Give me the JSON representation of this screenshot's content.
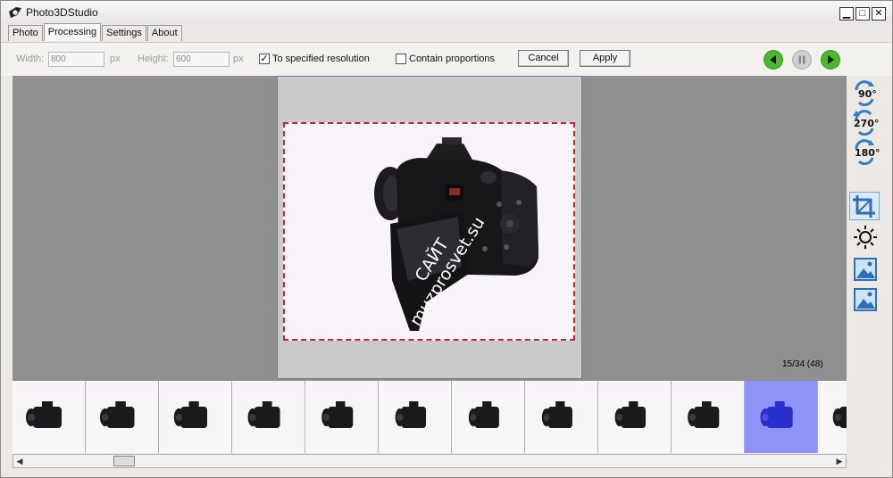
{
  "window": {
    "title": "Photo3DStudio"
  },
  "tabs": [
    {
      "label": "Photo"
    },
    {
      "label": "Processing"
    },
    {
      "label": "Settings"
    },
    {
      "label": "About"
    }
  ],
  "toolbar": {
    "width_label": "Width:",
    "width_value": "800",
    "width_unit": "px",
    "height_label": "Height:",
    "height_value": "600",
    "height_unit": "px",
    "resolution_label": "To specified resolution",
    "resolution_checked": true,
    "proportions_label": "Contain proportions",
    "proportions_checked": false,
    "cancel_label": "Cancel",
    "apply_label": "Apply"
  },
  "playback": {
    "prev_icon": "play-back-icon",
    "pause_icon": "pause-icon",
    "next_icon": "play-forward-icon"
  },
  "side_tools": [
    {
      "label": "90°",
      "icon": "rotate-90-icon"
    },
    {
      "label": "270°",
      "icon": "rotate-270-icon"
    },
    {
      "label": "180°",
      "icon": "rotate-180-icon"
    },
    {
      "icon": "crop-icon"
    },
    {
      "icon": "brightness-icon"
    },
    {
      "icon": "image-icon"
    },
    {
      "icon": "image-icon"
    }
  ],
  "viewer": {
    "watermark_line1": "САЙТ",
    "watermark_line2": "muzprosvet.su",
    "frame_counter": "15/34 (48)"
  },
  "filmstrip": {
    "thumb_count": 12,
    "selected_index": 10
  },
  "colors": {
    "selection": "#8f93f5",
    "crop_border": "#c0262b",
    "play_green": "#4cb92c"
  }
}
